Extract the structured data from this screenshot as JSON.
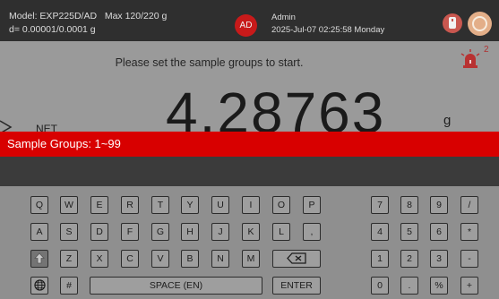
{
  "status": {
    "model": "Model: EXP225D/AD",
    "max": "Max 120/220 g",
    "resolution": "d= 0.00001/0.0001 g",
    "avatar": "AD",
    "user": "Admin",
    "datetime": "2025-Jul-07 02:25:58 Monday",
    "usb_icon": "usb-drive-icon",
    "level_icon": "level-bubble-icon"
  },
  "main": {
    "prompt": "Please set the sample groups to start.",
    "alarm_icon": "alarm-light-icon",
    "alarm_count": "2",
    "net_label": "NET",
    "weight": "4.28763",
    "unit": "g"
  },
  "input": {
    "label": "Sample Groups: 1~99",
    "value": ""
  },
  "keyboard": {
    "row1": [
      "Q",
      "W",
      "E",
      "R",
      "T",
      "Y",
      "U",
      "I",
      "O",
      "P"
    ],
    "row2": [
      "A",
      "S",
      "D",
      "F",
      "G",
      "H",
      "J",
      "K",
      "L",
      ","
    ],
    "row3": [
      "Z",
      "X",
      "C",
      "V",
      "B",
      "N",
      "M"
    ],
    "hash": "#",
    "space": "SPACE (EN)",
    "enter": "ENTER",
    "numpad": [
      [
        "7",
        "8",
        "9",
        "/"
      ],
      [
        "4",
        "5",
        "6",
        "*"
      ],
      [
        "1",
        "2",
        "3",
        "-"
      ],
      [
        "0",
        ".",
        "%",
        "+"
      ]
    ],
    "icons": {
      "shift": "shift-arrow-icon",
      "backspace": "backspace-icon",
      "language": "globe-icon"
    }
  }
}
